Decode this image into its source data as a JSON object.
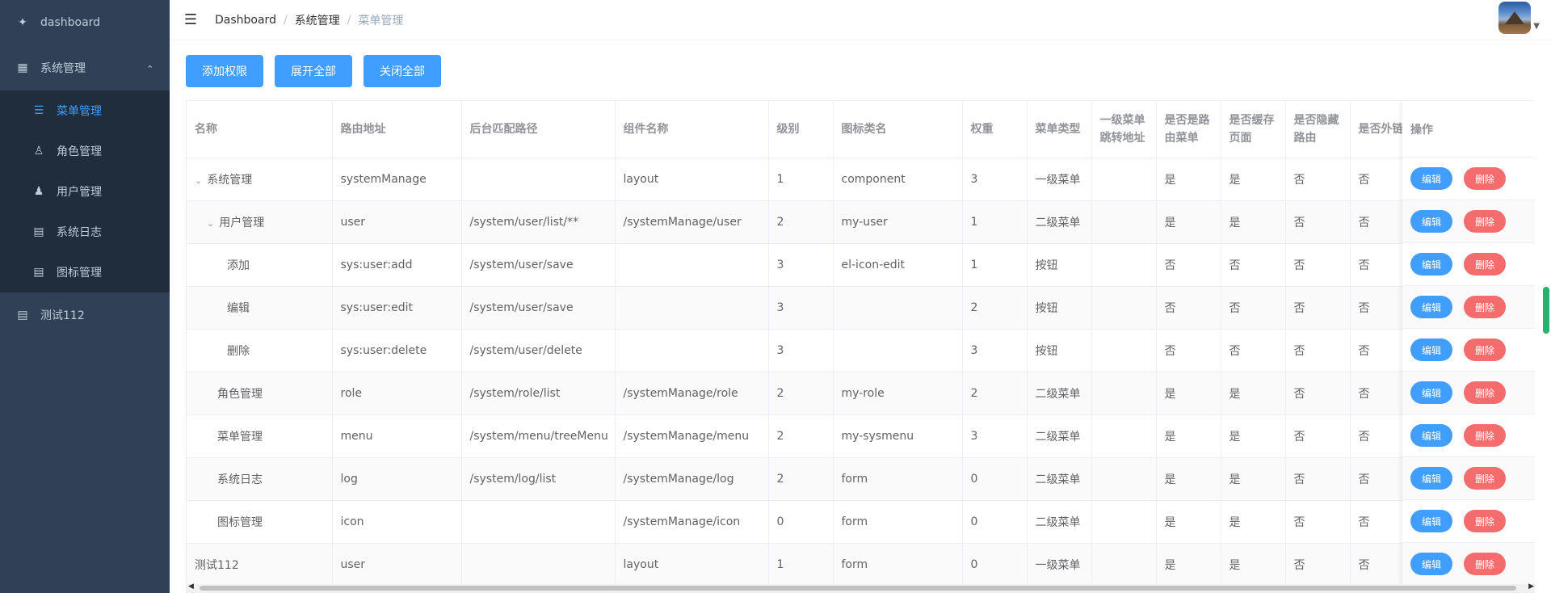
{
  "sidebar": {
    "dashboard": "dashboard",
    "system": "系统管理",
    "sub": [
      {
        "label": "菜单管理",
        "icon": "list-icon",
        "active": true
      },
      {
        "label": "角色管理",
        "icon": "role-icon",
        "active": false
      },
      {
        "label": "用户管理",
        "icon": "user-icon",
        "active": false
      },
      {
        "label": "系统日志",
        "icon": "doc-icon",
        "active": false
      },
      {
        "label": "图标管理",
        "icon": "doc-icon",
        "active": false
      }
    ],
    "test": "测试112"
  },
  "breadcrumb": [
    "Dashboard",
    "系统管理",
    "菜单管理"
  ],
  "toolbar": {
    "add": "添加权限",
    "expand": "展开全部",
    "collapse": "关闭全部"
  },
  "table": {
    "headers": [
      "名称",
      "路由地址",
      "后台匹配路径",
      "组件名称",
      "级别",
      "图标类名",
      "权重",
      "菜单类型",
      "一级菜单跳转地址",
      "是否是路由菜单",
      "是否缓存页面",
      "是否隐藏路由",
      "是否外链"
    ],
    "op_header": "操作",
    "edit_label": "编辑",
    "delete_label": "删除",
    "rows": [
      {
        "name": "系统管理",
        "route": "systemManage",
        "path": "",
        "comp": "layout",
        "level": "1",
        "icon": "component",
        "weight": "3",
        "type": "一级菜单",
        "jump": "",
        "isRoute": "是",
        "cache": "是",
        "hidden": "否",
        "ext": "否"
      },
      {
        "name": "用户管理",
        "route": "user",
        "path": "/system/user/list/**",
        "comp": "/systemManage/user",
        "level": "2",
        "icon": "my-user",
        "weight": "1",
        "type": "二级菜单",
        "jump": "",
        "isRoute": "是",
        "cache": "是",
        "hidden": "否",
        "ext": "否"
      },
      {
        "name": "添加",
        "route": "sys:user:add",
        "path": "/system/user/save",
        "comp": "",
        "level": "3",
        "icon": "el-icon-edit",
        "weight": "1",
        "type": "按钮",
        "jump": "",
        "isRoute": "否",
        "cache": "否",
        "hidden": "否",
        "ext": "否"
      },
      {
        "name": "编辑",
        "route": "sys:user:edit",
        "path": "/system/user/save",
        "comp": "",
        "level": "3",
        "icon": "",
        "weight": "2",
        "type": "按钮",
        "jump": "",
        "isRoute": "否",
        "cache": "否",
        "hidden": "否",
        "ext": "否"
      },
      {
        "name": "删除",
        "route": "sys:user:delete",
        "path": "/system/user/delete",
        "comp": "",
        "level": "3",
        "icon": "",
        "weight": "3",
        "type": "按钮",
        "jump": "",
        "isRoute": "否",
        "cache": "否",
        "hidden": "否",
        "ext": "否"
      },
      {
        "name": "角色管理",
        "route": "role",
        "path": "/system/role/list",
        "comp": "/systemManage/role",
        "level": "2",
        "icon": "my-role",
        "weight": "2",
        "type": "二级菜单",
        "jump": "",
        "isRoute": "是",
        "cache": "是",
        "hidden": "否",
        "ext": "否"
      },
      {
        "name": "菜单管理",
        "route": "menu",
        "path": "/system/menu/treeMenu",
        "comp": "/systemManage/menu",
        "level": "2",
        "icon": "my-sysmenu",
        "weight": "3",
        "type": "二级菜单",
        "jump": "",
        "isRoute": "是",
        "cache": "是",
        "hidden": "否",
        "ext": "否"
      },
      {
        "name": "系统日志",
        "route": "log",
        "path": "/system/log/list",
        "comp": "/systemManage/log",
        "level": "2",
        "icon": "form",
        "weight": "0",
        "type": "二级菜单",
        "jump": "",
        "isRoute": "是",
        "cache": "是",
        "hidden": "否",
        "ext": "否"
      },
      {
        "name": "图标管理",
        "route": "icon",
        "path": "",
        "comp": "/systemManage/icon",
        "level": "0",
        "icon": "form",
        "weight": "0",
        "type": "二级菜单",
        "jump": "",
        "isRoute": "是",
        "cache": "是",
        "hidden": "否",
        "ext": "否"
      },
      {
        "name": "测试112",
        "route": "user",
        "path": "",
        "comp": "layout",
        "level": "1",
        "icon": "form",
        "weight": "0",
        "type": "一级菜单",
        "jump": "",
        "isRoute": "是",
        "cache": "是",
        "hidden": "否",
        "ext": "否"
      }
    ]
  },
  "colors": {
    "sidebar": "#304156",
    "submenu": "#1f2d3d",
    "primary": "#409eff",
    "danger": "#f56c6c"
  }
}
